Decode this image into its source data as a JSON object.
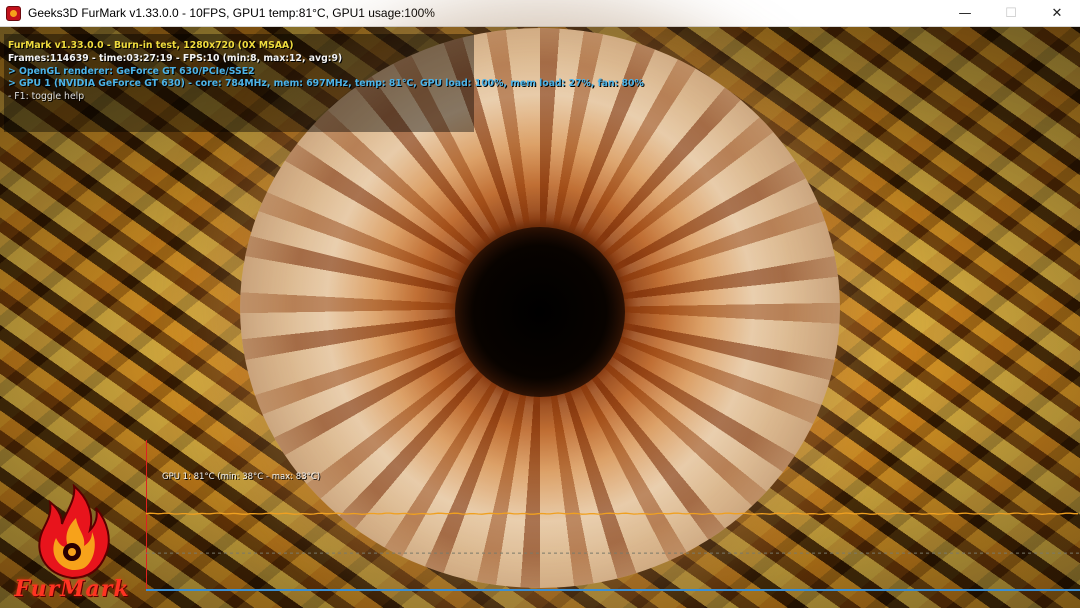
{
  "window": {
    "title": "Geeks3D FurMark v1.33.0.0 - 10FPS, GPU1 temp:81°C, GPU1 usage:100%",
    "minimize_glyph": "—",
    "maximize_glyph": "☐",
    "close_glyph": "✕"
  },
  "osd": {
    "line1": "FurMark v1.33.0.0 - Burn-in test, 1280x720 (0X MSAA)",
    "line2": "Frames:114639 - time:03:27:19 - FPS:10 (min:8, max:12, avg:9)",
    "line3": "> OpenGL renderer: GeForce GT 630/PCIe/SSE2",
    "line4": "> GPU 1 (NVIDIA GeForce GT 630) - core: 784MHz, mem: 697MHz, temp: 81°C, GPU load: 100%, mem load: 27%, fan: 80%",
    "line5": "- F1: toggle help"
  },
  "graph": {
    "label": "GPU 1: 81°C (min: 38°C - max: 83°C)",
    "current_temp": 81,
    "min_temp": 38,
    "max_temp": 83
  },
  "logo": {
    "text": "FurMark"
  },
  "colors": {
    "osd_title": "#f0dc3e",
    "osd_info": "#4cb3e8",
    "temp_curve": "#f0a020",
    "graph_yaxis": "#e02020",
    "graph_xaxis": "#3a8fd4"
  }
}
